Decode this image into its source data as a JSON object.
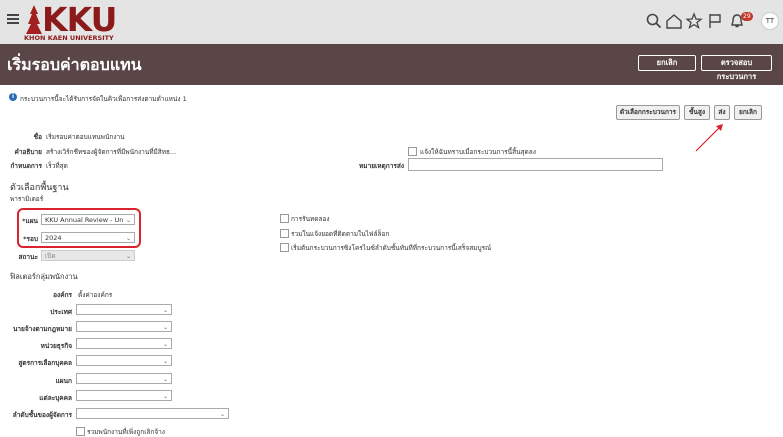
{
  "header": {
    "logo_text": "KKU",
    "logo_sub": "KHON KAEN UNIVERSITY",
    "notification_count": "29",
    "avatar_initials": "TT",
    "icons": [
      "menu-icon",
      "search-icon",
      "home-icon",
      "star-icon",
      "flag-icon",
      "bell-icon"
    ]
  },
  "titlebar": {
    "title": "เริ่มรอบค่าตอบแทน",
    "cancel_label": "ยกเลิก",
    "review_label": "ตรวจสอบกระบวนการ"
  },
  "info": {
    "message": "กระบวนการนี้จะได้รับการจัดในคิวเพื่อการส่งตามตำแหน่ง 1"
  },
  "actions": {
    "process_options": "ตัวเลือกกระบวนการ",
    "advanced": "ขั้นสูง",
    "submit": "ส่ง",
    "cancel": "ยกเลิก"
  },
  "details": {
    "name_label": "ชื่อ",
    "name_value": "เริ่มรอบค่าตอบแทนพนักงาน",
    "desc_label": "คำอธิบาย",
    "desc_value": "สร้างเวิร์กชีทของผู้จัดการที่มีพนักงานที่มีสิทธ...",
    "schedule_label": "กำหนดการ",
    "schedule_value": "เร็วที่สุด",
    "notify_label": "แจ้งให้ฉันทราบเมื่อกระบวนการนี้สิ้นสุดลง",
    "note_label": "หมายเหตุการส่ง",
    "note_value": ""
  },
  "basic": {
    "heading": "ตัวเลือกพื้นฐาน",
    "params_label": "พารามิเตอร์",
    "plan_label": "*แผน",
    "plan_value": "KKU Annual Review - Un",
    "cycle_label": "*รอบ",
    "cycle_value": "2024",
    "status_label": "สถานะ",
    "status_value": "เปิด",
    "opt1": "การรันทดลอง",
    "opt2": "รวมในแจ้งยอดที่ติดตามในไฟล์ล็อก",
    "opt3": "เริ่มต้นกระบวนการซิงโครไนซ์ลำดับชั้นทันทีที่กระบวนการนี้เสร็จสมบูรณ์"
  },
  "filters": {
    "heading": "ฟิลเตอร์กลุ่มพนักงาน",
    "org_label": "องค์กร",
    "org_value": "ตั้งค่าองค์กร",
    "country_label": "ประเทศ",
    "legal_employer_label": "นายจ้างตามกฎหมาย",
    "business_unit_label": "หน่วยธุรกิจ",
    "formula_label": "สูตรการเลือกบุคคล",
    "department_label": "แผนก",
    "person_label": "แต่ละบุคคล",
    "manager_hierarchy_label": "ลำดับชั้นของผู้จัดการ",
    "include_terminated_label": "รวมพนักงานที่เพิ่งถูกเลิกจ้าง"
  }
}
